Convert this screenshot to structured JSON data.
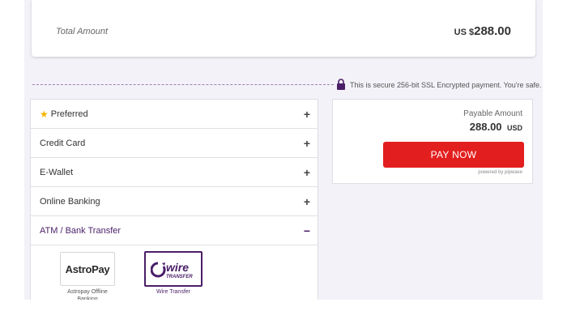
{
  "summary": {
    "total_label": "Total Amount",
    "currency": "US $",
    "amount": "288.00"
  },
  "security": {
    "message": "This is secure 256-bit SSL Encrypted payment. You're safe.",
    "icon": "lock-icon"
  },
  "methods": [
    {
      "label": "Preferred",
      "toggle": "+",
      "icon": "star-icon"
    },
    {
      "label": "Credit Card",
      "toggle": "+"
    },
    {
      "label": "E-Wallet",
      "toggle": "+"
    },
    {
      "label": "Online Banking",
      "toggle": "+"
    },
    {
      "label": "ATM / Bank Transfer",
      "toggle": "−",
      "expanded": true
    }
  ],
  "bank_options": [
    {
      "name": "Astropay Offline Banking",
      "logo_text": "AstroPay"
    },
    {
      "name": "Wire Transfer",
      "logo_text": "wire",
      "logo_subtext": "TRANSFER",
      "selected": true
    }
  ],
  "payment": {
    "payable_label": "Payable Amount",
    "amount": "288.00",
    "currency": "USD",
    "button_label": "PAY NOW",
    "powered_by": "powered by pipwave"
  },
  "colors": {
    "accent_purple": "#4a1f68",
    "pay_red": "#e31e1e",
    "star_gold": "#f5b400",
    "page_bg": "#f3f2f8"
  }
}
